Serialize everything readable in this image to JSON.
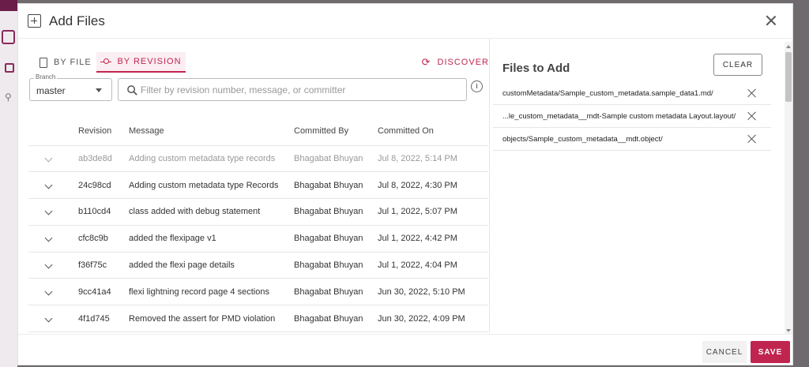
{
  "dialog": {
    "title": "Add Files",
    "close_icon": "close-icon"
  },
  "tabs": {
    "by_file": "BY FILE",
    "by_revision": "BY REVISION",
    "active": "by_revision"
  },
  "discover_label": "DISCOVER",
  "branch": {
    "label": "Branch",
    "value": "master"
  },
  "filter": {
    "placeholder": "Filter by revision number, message, or committer",
    "value": ""
  },
  "table": {
    "headers": {
      "revision": "Revision",
      "message": "Message",
      "committed_by": "Committed By",
      "committed_on": "Committed On"
    },
    "rows": [
      {
        "revision": "ab3de8d",
        "message": "Adding custom metadata type records",
        "committed_by": "Bhagabat Bhuyan",
        "committed_on": "Jul 8, 2022, 5:14 PM"
      },
      {
        "revision": "24c98cd",
        "message": "Adding custom metadata type Records",
        "committed_by": "Bhagabat Bhuyan",
        "committed_on": "Jul 8, 2022, 4:30 PM"
      },
      {
        "revision": "b110cd4",
        "message": "class added with debug statement",
        "committed_by": "Bhagabat Bhuyan",
        "committed_on": "Jul 1, 2022, 5:07 PM"
      },
      {
        "revision": "cfc8c9b",
        "message": "added the flexipage v1",
        "committed_by": "Bhagabat Bhuyan",
        "committed_on": "Jul 1, 2022, 4:42 PM"
      },
      {
        "revision": "f36f75c",
        "message": "added the flexi page details",
        "committed_by": "Bhagabat Bhuyan",
        "committed_on": "Jul 1, 2022, 4:04 PM"
      },
      {
        "revision": "9cc41a4",
        "message": "flexi lightning record page 4 sections",
        "committed_by": "Bhagabat Bhuyan",
        "committed_on": "Jun 30, 2022, 5:10 PM"
      },
      {
        "revision": "4f1d745",
        "message": "Removed the assert for PMD violation",
        "committed_by": "Bhagabat Bhuyan",
        "committed_on": "Jun 30, 2022, 4:09 PM"
      }
    ]
  },
  "files_to_add": {
    "title": "Files to Add",
    "clear_label": "CLEAR",
    "files": [
      "customMetadata/Sample_custom_metadata.sample_data1.md/",
      "...le_custom_metadata__mdt-Sample custom metadata Layout.layout/",
      "objects/Sample_custom_metadata__mdt.object/"
    ]
  },
  "footer": {
    "cancel_label": "CANCEL",
    "save_label": "SAVE"
  },
  "colors": {
    "accent": "#c0254f",
    "accent_bg": "#fbeef2"
  }
}
